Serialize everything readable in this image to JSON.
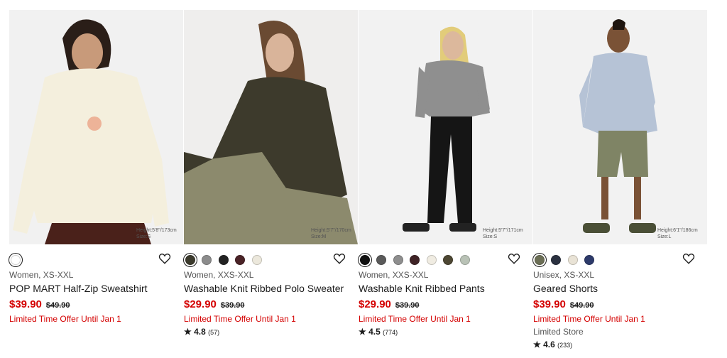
{
  "products": [
    {
      "height_info": "Height:5'8\"/173cm Size:S",
      "swatches": [
        "#ffffff"
      ],
      "selected_swatch": 0,
      "meta": "Women, XS-XXL",
      "name": "POP MART Half-Zip Sweatshirt",
      "price": "$39.90",
      "was_price": "$49.90",
      "promo": "Limited Time Offer Until Jan 1",
      "store": "",
      "rating": "",
      "rating_count": ""
    },
    {
      "height_info": "Height:5'7\"/170cm Size:M",
      "swatches": [
        "#3b3a2c",
        "#8c8c8c",
        "#222222",
        "#4a2327",
        "#ece8dc"
      ],
      "selected_swatch": 0,
      "meta": "Women, XXS-XXL",
      "name": "Washable Knit Ribbed Polo Sweater",
      "price": "$29.90",
      "was_price": "$39.90",
      "promo": "Limited Time Offer Until Jan 1",
      "store": "",
      "rating": "4.8",
      "rating_count": "(57)"
    },
    {
      "height_info": "Height:5'7\"/171cm Size:S",
      "swatches": [
        "#111111",
        "#5a5a5a",
        "#8e8e8e",
        "#3f2326",
        "#f0ece2",
        "#4d4733",
        "#b9c2b6"
      ],
      "selected_swatch": 0,
      "meta": "Women, XXS-XXL",
      "name": "Washable Knit Ribbed Pants",
      "price": "$29.90",
      "was_price": "$39.90",
      "promo": "Limited Time Offer Until Jan 1",
      "store": "",
      "rating": "4.5",
      "rating_count": "(774)"
    },
    {
      "height_info": "Height:6'1\"/186cm Size:L",
      "swatches": [
        "#6b6e55",
        "#2b3140",
        "#e9e3d6",
        "#2d3a6a"
      ],
      "selected_swatch": 0,
      "meta": "Unisex, XS-XXL",
      "name": "Geared Shorts",
      "price": "$39.90",
      "was_price": "$49.90",
      "promo": "Limited Time Offer Until Jan 1",
      "store": "Limited Store",
      "rating": "4.6",
      "rating_count": "(233)"
    }
  ],
  "icons": {
    "wishlist": "heart-outline-icon",
    "rating": "star-icon"
  }
}
